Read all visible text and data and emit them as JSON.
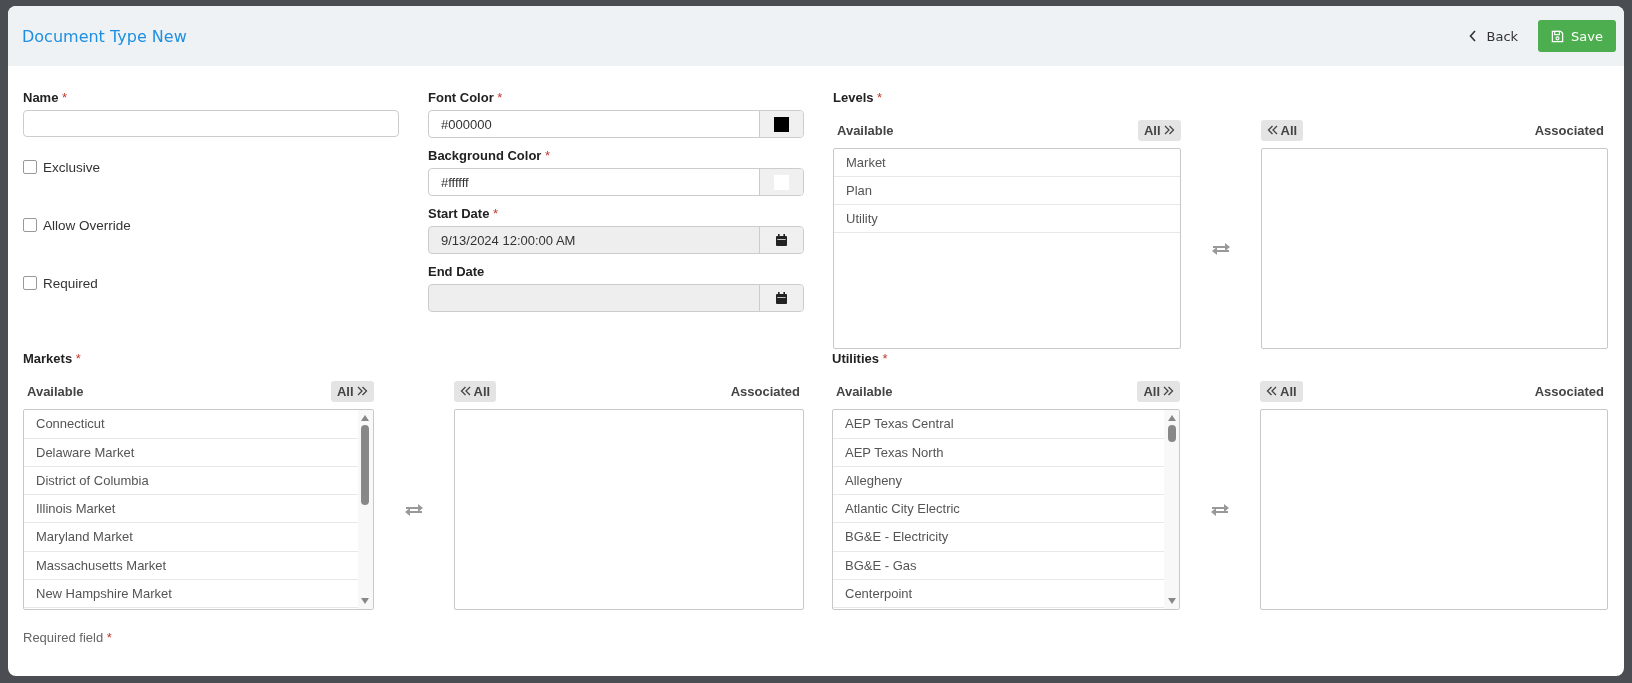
{
  "dialog": {
    "title": "Document Type New",
    "back_label": "Back",
    "save_label": "Save"
  },
  "name_field": {
    "label": "Name",
    "required_mark": "*"
  },
  "checkboxes": [
    {
      "label": "Exclusive",
      "checked": false
    },
    {
      "label": "Allow Override",
      "checked": false
    },
    {
      "label": "Required",
      "checked": false
    }
  ],
  "fields": [
    {
      "kind": "color",
      "label": "Font Color",
      "required_mark": "*",
      "value": "#000000",
      "disabled": false
    },
    {
      "kind": "color",
      "label": "Background Color",
      "required_mark": "*",
      "value": "#ffffff",
      "disabled": false
    },
    {
      "kind": "date",
      "label": "Start Date",
      "required_mark": "*",
      "value": "9/13/2024 12:00:00 AM",
      "disabled": true
    },
    {
      "kind": "date",
      "label": "End Date",
      "disabled": true
    }
  ],
  "levels": {
    "label": "Levels",
    "required_mark": "*",
    "available_label": "Available",
    "add_all_label": "All",
    "remove_all_label": "All",
    "associated_label": "Associated",
    "scrollable": false,
    "available": [
      "Market",
      "Plan",
      "Utility"
    ]
  },
  "markets": {
    "label": "Markets",
    "required_mark": "*",
    "available_label": "Available",
    "add_all_label": "All",
    "remove_all_label": "All",
    "associated_label": "Associated",
    "scrollable": true,
    "available": [
      "Connecticut",
      "Delaware Market",
      "District of Columbia",
      "Illinois Market",
      "Maryland Market",
      "Massachusetts Market",
      "New Hampshire Market"
    ]
  },
  "utilities": {
    "label": "Utilities",
    "required_mark": "*",
    "available_label": "Available",
    "add_all_label": "All",
    "remove_all_label": "All",
    "associated_label": "Associated",
    "scrollable": true,
    "available": [
      "AEP Texas Central",
      "AEP Texas North",
      "Allegheny",
      "Atlantic City Electric",
      "BG&E - Electricity",
      "BG&E - Gas",
      "Centerpoint"
    ]
  },
  "footer_note": {
    "text": "Required field",
    "required_mark": "*"
  }
}
